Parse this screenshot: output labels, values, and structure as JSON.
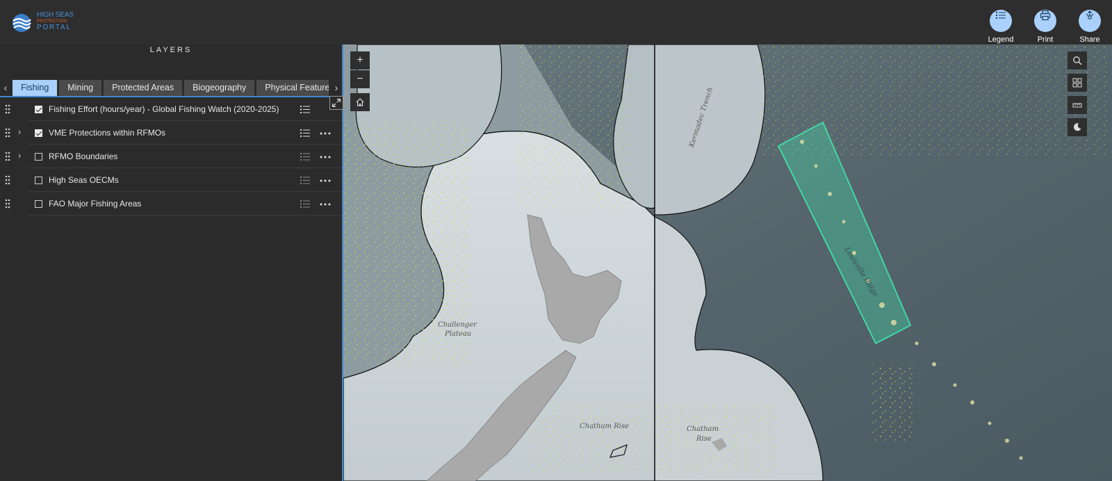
{
  "app": {
    "logo_line1": "HIGH SEAS",
    "logo_line2": "PROTECTION",
    "logo_line3": "PORTAL"
  },
  "toolbar": {
    "legend_label": "Legend",
    "print_label": "Print",
    "share_label": "Share",
    "button_color": "#a9d1fb"
  },
  "panel": {
    "title": "LAYERS",
    "tabs": [
      {
        "label": "Fishing",
        "active": true
      },
      {
        "label": "Mining",
        "active": false
      },
      {
        "label": "Protected Areas",
        "active": false
      },
      {
        "label": "Biogeography",
        "active": false
      },
      {
        "label": "Physical Features",
        "active": false
      }
    ],
    "layers": [
      {
        "label": "Fishing Effort (hours/year) - Global Fishing Watch (2020-2025)",
        "checked": true,
        "expandable": false
      },
      {
        "label": "VME Protections within RFMOs",
        "checked": true,
        "expandable": true
      },
      {
        "label": "RFMO Boundaries",
        "checked": false,
        "expandable": true
      },
      {
        "label": "High Seas OECMs",
        "checked": false,
        "expandable": false
      },
      {
        "label": "FAO Major Fishing Areas",
        "checked": false,
        "expandable": false
      }
    ]
  },
  "map": {
    "zoom_in": "+",
    "zoom_out": "−",
    "labels": {
      "challenger": "Challenger",
      "plateau": "Plateau",
      "chatham_rise": "Chatham Rise",
      "chatham": "Chatham",
      "chatham_isl": "Rise",
      "kermadec": "Kermadec Trench",
      "louisville": "Louisville Ridge"
    },
    "tools": [
      "search-icon",
      "basemap-gallery-icon",
      "measure-icon",
      "dark-mode-icon"
    ],
    "vme_color": "#3fe0a8"
  }
}
